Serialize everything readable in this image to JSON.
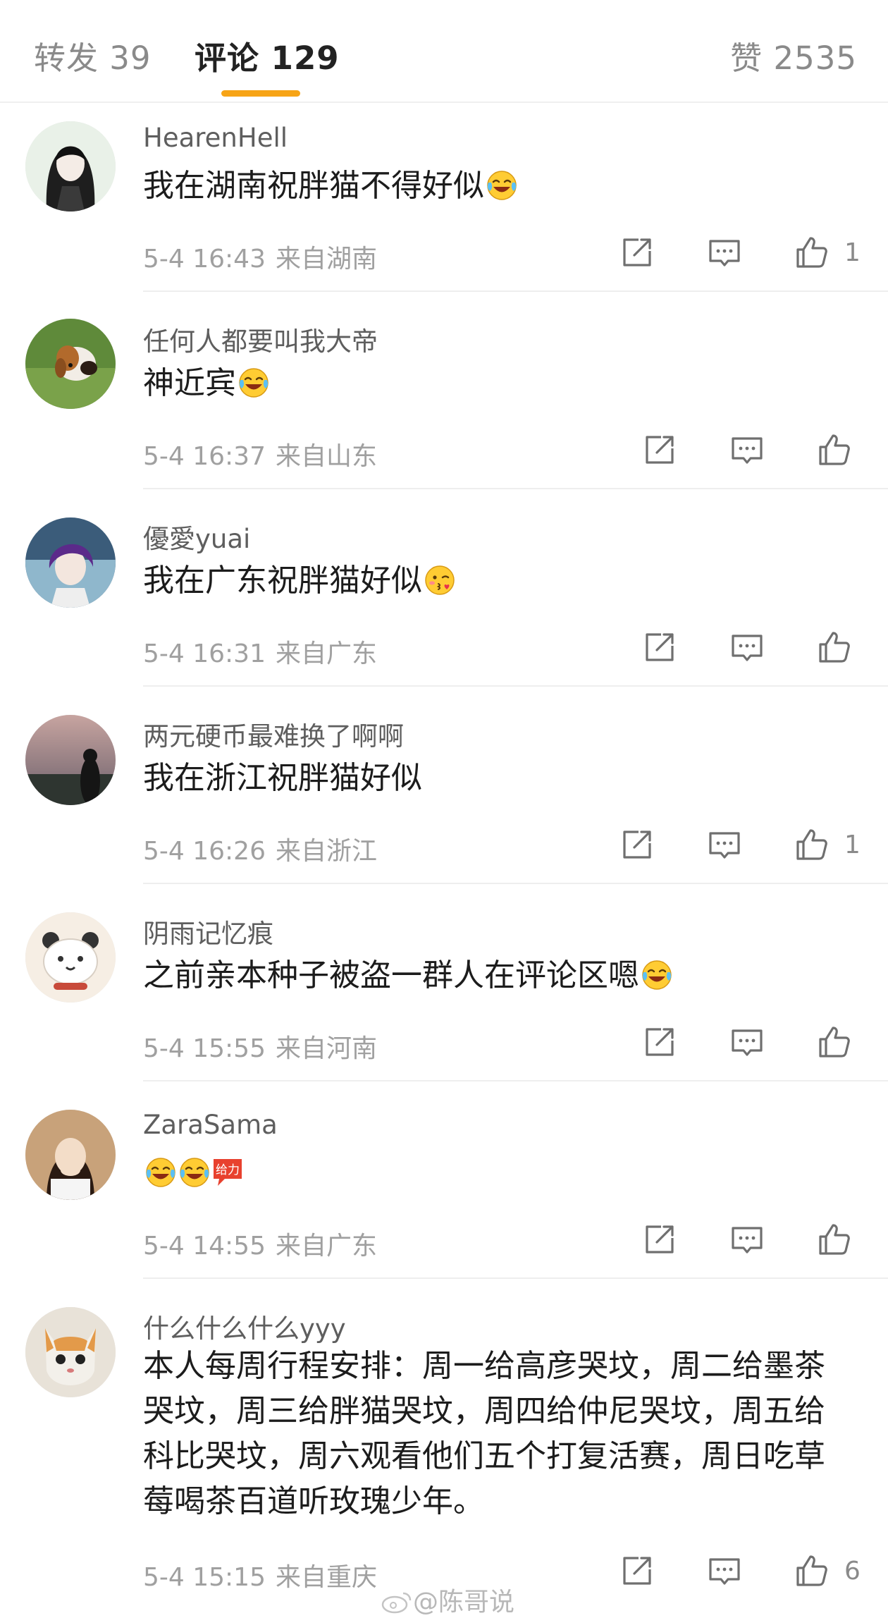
{
  "tabs": {
    "repost": "转发 39",
    "comments": "评论 129",
    "likes": "赞 2535"
  },
  "colors": {
    "accent": "#f7a416",
    "muted": "#a0a0a0"
  },
  "comments": [
    {
      "user": "HearenHell",
      "text": "我在湖南祝胖猫不得好似",
      "emoji": "laugh-cry",
      "time": "5-4 16:43",
      "location": "来自湖南",
      "likes": "1"
    },
    {
      "user": "任何人都要叫我大帝",
      "text": "神近宾",
      "emoji": "laugh-cry",
      "time": "5-4 16:37",
      "location": "来自山东",
      "likes": ""
    },
    {
      "user": "優愛yuai",
      "text": "我在广东祝胖猫好似",
      "emoji": "kiss-heart",
      "time": "5-4 16:31",
      "location": "来自广东",
      "likes": ""
    },
    {
      "user": "两元硬币最难换了啊啊",
      "text": "我在浙江祝胖猫好似",
      "emoji": "",
      "time": "5-4 16:26",
      "location": "来自浙江",
      "likes": "1"
    },
    {
      "user": "阴雨记忆痕",
      "text": "之前亲本种子被盗一群人在评论区嗯",
      "emoji": "laugh-cry",
      "time": "5-4 15:55",
      "location": "来自河南",
      "likes": ""
    },
    {
      "user": "ZaraSama",
      "text": "",
      "emoji": "laugh-cry x2 + 给力",
      "sticker_text": "给力",
      "time": "5-4 14:55",
      "location": "来自广东",
      "likes": ""
    },
    {
      "user": "什么什么什么yyy",
      "text": "本人每周行程安排：周一给高彦哭坟，周二给墨茶哭坟，周三给胖猫哭坟，周四给仲尼哭坟，周五给科比哭坟，周六观看他们五个打复活赛，周日吃草莓喝茶百道听玫瑰少年。",
      "emoji": "",
      "time": "5-4 15:15",
      "location": "来自重庆",
      "likes": "6"
    }
  ],
  "icons": {
    "share": "share-icon",
    "comment": "comment-icon",
    "like": "thumbs-up-icon"
  },
  "watermark": "@陈哥说"
}
